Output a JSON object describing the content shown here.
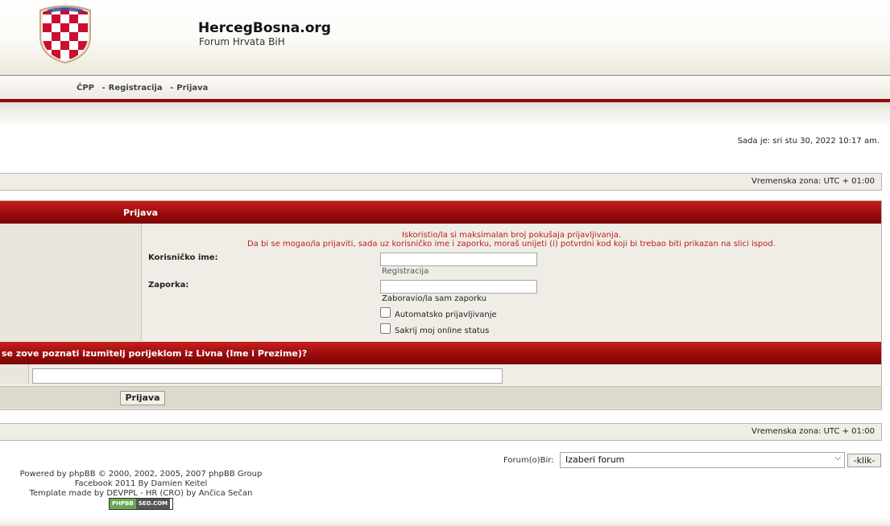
{
  "header": {
    "site_title": "HercegBosna.org",
    "site_subtitle": "Forum Hrvata BiH",
    "logo_icon": "checkerboard-shield-icon"
  },
  "nav": {
    "faq": "ČPP",
    "register": "Registracija",
    "login": "Prijava",
    "separator": "-"
  },
  "status": {
    "now": "Sada je: sri stu 30, 2022 10:17 am.",
    "timezone": "Vremenska zona: UTC + 01:00"
  },
  "login_form": {
    "title": "Prijava",
    "error_line1": "Iskoristio/la si maksimalan broj pokušaja prijavljivanja.",
    "error_line2": "Da bi se mogao/la prijaviti, sada uz korisničko ime i zaporku, moraš unijeti (i) potvrdni kod koji bi trebao biti prikazan na slici ispod.",
    "username_label": "Korisničko ime:",
    "username_value": "",
    "register_link": "Registracija",
    "password_label": "Zaporka:",
    "password_value": "",
    "forgot_link": "Zaboravio/la sam zaporku",
    "auto_login_label": "Automatsko prijavljivanje",
    "auto_login_checked": false,
    "hide_status_label": "Sakrij moj online status",
    "hide_status_checked": false
  },
  "question": {
    "text": "se zove poznati izumitelj porijeklom iz Livna (Ime i Prezime)?",
    "answer_value": ""
  },
  "submit_label": "Prijava",
  "jump": {
    "label": "Forum(o)Bir:",
    "selected": "Izaberi forum",
    "button": "-klik-"
  },
  "credits": {
    "line1": "Powered by phpBB © 2000, 2002, 2005, 2007 phpBB Group",
    "line2": "Facebook 2011 By Damien Keitel",
    "line3": "Template made by DEVPPL - HR (CRO) by Ančica Sečan",
    "badge_left": "PHPBB",
    "badge_right": "SEO.COM"
  },
  "colors": {
    "accent_red": "#9a0c0c",
    "error_text": "#c11b1b",
    "panel_bg": "#efede6"
  }
}
